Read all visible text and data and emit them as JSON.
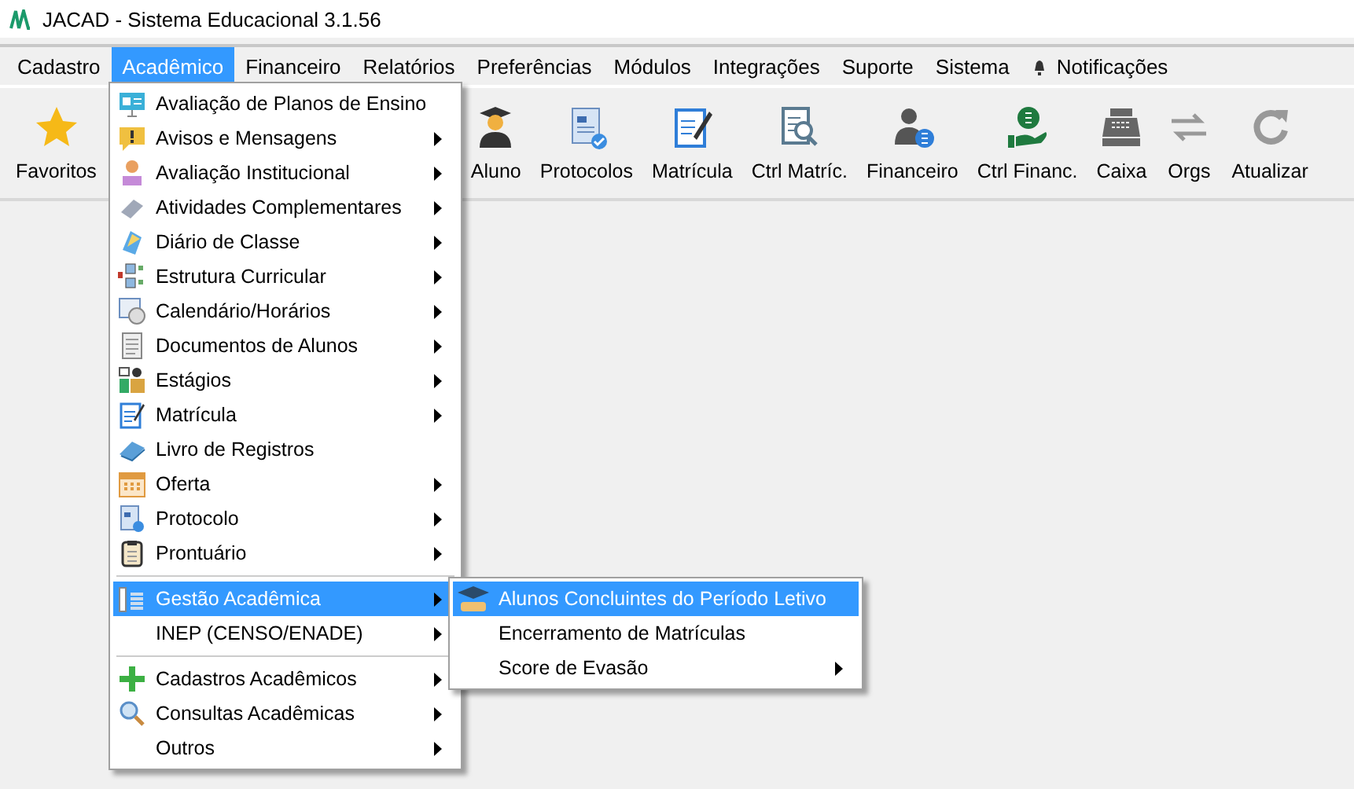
{
  "window": {
    "title": "JACAD - Sistema Educacional 3.1.56"
  },
  "menubar": [
    {
      "label": "Cadastro",
      "selected": false
    },
    {
      "label": "Acadêmico",
      "selected": true
    },
    {
      "label": "Financeiro",
      "selected": false
    },
    {
      "label": "Relatórios",
      "selected": false
    },
    {
      "label": "Preferências",
      "selected": false
    },
    {
      "label": "Módulos",
      "selected": false
    },
    {
      "label": "Integrações",
      "selected": false
    },
    {
      "label": "Suporte",
      "selected": false
    },
    {
      "label": "Sistema",
      "selected": false
    },
    {
      "label": "Notificações",
      "selected": false
    }
  ],
  "toolbar": [
    {
      "label": "Favoritos"
    },
    {
      "label": "Aluno"
    },
    {
      "label": "Protocolos"
    },
    {
      "label": "Matrícula"
    },
    {
      "label": "Ctrl Matríc."
    },
    {
      "label": "Financeiro"
    },
    {
      "label": "Ctrl Financ."
    },
    {
      "label": "Caixa"
    },
    {
      "label": "Orgs"
    },
    {
      "label": "Atualizar"
    }
  ],
  "menu": {
    "groups": [
      [
        {
          "label": "Avaliação de Planos de Ensino",
          "submenu": false,
          "selected": false
        },
        {
          "label": "Avisos e Mensagens",
          "submenu": true,
          "selected": false
        },
        {
          "label": "Avaliação Institucional",
          "submenu": true,
          "selected": false
        },
        {
          "label": "Atividades Complementares",
          "submenu": true,
          "selected": false
        },
        {
          "label": "Diário de Classe",
          "submenu": true,
          "selected": false
        },
        {
          "label": "Estrutura Curricular",
          "submenu": true,
          "selected": false
        },
        {
          "label": "Calendário/Horários",
          "submenu": true,
          "selected": false
        },
        {
          "label": "Documentos de Alunos",
          "submenu": true,
          "selected": false
        },
        {
          "label": "Estágios",
          "submenu": true,
          "selected": false
        },
        {
          "label": "Matrícula",
          "submenu": true,
          "selected": false
        },
        {
          "label": "Livro de Registros",
          "submenu": false,
          "selected": false
        },
        {
          "label": "Oferta",
          "submenu": true,
          "selected": false
        },
        {
          "label": "Protocolo",
          "submenu": true,
          "selected": false
        },
        {
          "label": "Prontuário",
          "submenu": true,
          "selected": false
        }
      ],
      [
        {
          "label": "Gestão Acadêmica",
          "submenu": true,
          "selected": true
        },
        {
          "label": "INEP (CENSO/ENADE)",
          "submenu": true,
          "selected": false
        }
      ],
      [
        {
          "label": "Cadastros Acadêmicos",
          "submenu": true,
          "selected": false
        },
        {
          "label": "Consultas Acadêmicas",
          "submenu": true,
          "selected": false
        },
        {
          "label": "Outros",
          "submenu": true,
          "selected": false
        }
      ]
    ]
  },
  "submenu": {
    "items": [
      {
        "label": "Alunos Concluintes do Período Letivo",
        "submenu": false,
        "selected": true
      },
      {
        "label": "Encerramento de Matrículas",
        "submenu": false,
        "selected": false
      },
      {
        "label": "Score de Evasão",
        "submenu": true,
        "selected": false
      }
    ]
  }
}
